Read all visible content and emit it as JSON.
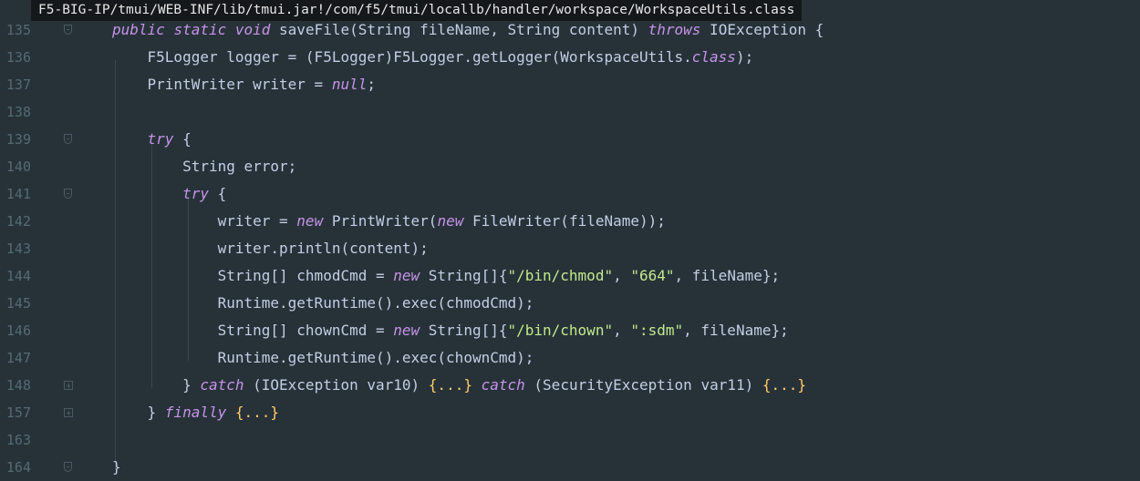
{
  "tooltip": {
    "path": "F5-BIG-IP/tmui/WEB-INF/lib/tmui.jar!/com/f5/tmui/locallb/handler/workspace/WorkspaceUtils.class"
  },
  "colors": {
    "background": "#263238",
    "keyword": "#c792ea",
    "string": "#c3e88d",
    "folded": "#ffcb6b",
    "text": "#c3cee3",
    "line_number": "#566a74"
  },
  "lines": [
    {
      "num": "135",
      "fold": "start",
      "tokens": [
        {
          "t": "kw",
          "v": "public"
        },
        {
          "t": "plain",
          "v": " "
        },
        {
          "t": "kw",
          "v": "static"
        },
        {
          "t": "plain",
          "v": " "
        },
        {
          "t": "kw",
          "v": "void"
        },
        {
          "t": "plain",
          "v": " saveFile(String fileName, String content) "
        },
        {
          "t": "kw",
          "v": "throws"
        },
        {
          "t": "plain",
          "v": " IOException {"
        }
      ]
    },
    {
      "num": "136",
      "fold": "",
      "tokens": [
        {
          "t": "plain",
          "v": "    F5Logger logger = (F5Logger)F5Logger.getLogger(WorkspaceUtils."
        },
        {
          "t": "kw",
          "v": "class"
        },
        {
          "t": "plain",
          "v": ");"
        }
      ]
    },
    {
      "num": "137",
      "fold": "",
      "tokens": [
        {
          "t": "plain",
          "v": "    PrintWriter writer = "
        },
        {
          "t": "kw",
          "v": "null"
        },
        {
          "t": "plain",
          "v": ";"
        }
      ]
    },
    {
      "num": "138",
      "fold": "",
      "tokens": []
    },
    {
      "num": "139",
      "fold": "start",
      "tokens": [
        {
          "t": "plain",
          "v": "    "
        },
        {
          "t": "kw",
          "v": "try"
        },
        {
          "t": "plain",
          "v": " {"
        }
      ]
    },
    {
      "num": "140",
      "fold": "",
      "tokens": [
        {
          "t": "plain",
          "v": "        String error;"
        }
      ]
    },
    {
      "num": "141",
      "fold": "start",
      "tokens": [
        {
          "t": "plain",
          "v": "        "
        },
        {
          "t": "kw",
          "v": "try"
        },
        {
          "t": "plain",
          "v": " {"
        }
      ]
    },
    {
      "num": "142",
      "fold": "",
      "tokens": [
        {
          "t": "plain",
          "v": "            writer = "
        },
        {
          "t": "kw",
          "v": "new"
        },
        {
          "t": "plain",
          "v": " PrintWriter("
        },
        {
          "t": "kw",
          "v": "new"
        },
        {
          "t": "plain",
          "v": " FileWriter(fileName));"
        }
      ]
    },
    {
      "num": "143",
      "fold": "",
      "tokens": [
        {
          "t": "plain",
          "v": "            writer.println(content);"
        }
      ]
    },
    {
      "num": "144",
      "fold": "",
      "tokens": [
        {
          "t": "plain",
          "v": "            String[] chmodCmd = "
        },
        {
          "t": "kw",
          "v": "new"
        },
        {
          "t": "plain",
          "v": " String[]{"
        },
        {
          "t": "str",
          "v": "\"/bin/chmod\""
        },
        {
          "t": "plain",
          "v": ", "
        },
        {
          "t": "str",
          "v": "\"664\""
        },
        {
          "t": "plain",
          "v": ", fileName};"
        }
      ]
    },
    {
      "num": "145",
      "fold": "",
      "tokens": [
        {
          "t": "plain",
          "v": "            Runtime.getRuntime().exec(chmodCmd);"
        }
      ]
    },
    {
      "num": "146",
      "fold": "",
      "tokens": [
        {
          "t": "plain",
          "v": "            String[] chownCmd = "
        },
        {
          "t": "kw",
          "v": "new"
        },
        {
          "t": "plain",
          "v": " String[]{"
        },
        {
          "t": "str",
          "v": "\"/bin/chown\""
        },
        {
          "t": "plain",
          "v": ", "
        },
        {
          "t": "str",
          "v": "\":sdm\""
        },
        {
          "t": "plain",
          "v": ", fileName};"
        }
      ]
    },
    {
      "num": "147",
      "fold": "",
      "tokens": [
        {
          "t": "plain",
          "v": "            Runtime.getRuntime().exec(chownCmd);"
        }
      ]
    },
    {
      "num": "148",
      "fold": "plus",
      "tokens": [
        {
          "t": "plain",
          "v": "        } "
        },
        {
          "t": "kw",
          "v": "catch"
        },
        {
          "t": "plain",
          "v": " (IOException var10) "
        },
        {
          "t": "fold-text",
          "v": "{...}"
        },
        {
          "t": "plain",
          "v": " "
        },
        {
          "t": "kw",
          "v": "catch"
        },
        {
          "t": "plain",
          "v": " (SecurityException var11) "
        },
        {
          "t": "fold-text",
          "v": "{...}"
        }
      ]
    },
    {
      "num": "157",
      "fold": "plus",
      "tokens": [
        {
          "t": "plain",
          "v": "    } "
        },
        {
          "t": "kw",
          "v": "finally"
        },
        {
          "t": "plain",
          "v": " "
        },
        {
          "t": "fold-text",
          "v": "{...}"
        }
      ]
    },
    {
      "num": "163",
      "fold": "",
      "tokens": []
    },
    {
      "num": "164",
      "fold": "end",
      "tokens": [
        {
          "t": "plain",
          "v": "}"
        }
      ]
    }
  ]
}
